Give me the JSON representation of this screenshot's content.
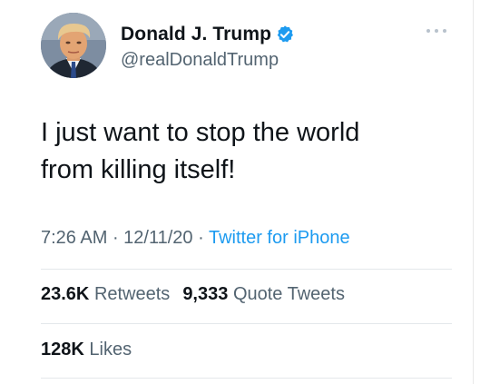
{
  "author": {
    "name": "Donald J. Trump",
    "handle": "@realDonaldTrump",
    "verified": true,
    "avatar_icon": "profile-photo"
  },
  "tweet": {
    "text": "I just want to stop the world\nfrom killing itself!",
    "time": "7:26 AM",
    "date": "12/11/20",
    "separator": " · ",
    "source": "Twitter for iPhone"
  },
  "stats": {
    "retweets_count": "23.6K",
    "retweets_label": "Retweets",
    "quote_count": "9,333",
    "quote_label": "Quote Tweets",
    "likes_count": "128K",
    "likes_label": "Likes"
  },
  "colors": {
    "accent": "#1d9bf0",
    "secondary_text": "#536471",
    "primary_text": "#0f1419",
    "divider": "#e4e8eb"
  },
  "icons": {
    "verified": "verified-badge-icon",
    "more": "more-options-icon"
  }
}
